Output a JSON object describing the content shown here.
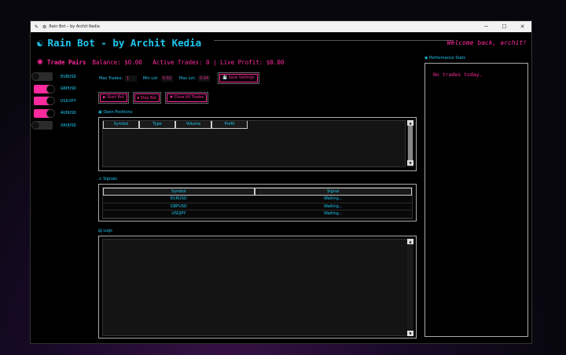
{
  "window": {
    "title": "Rain Bot – by Archit Kedia",
    "controls": [
      "─",
      "☐",
      "✕"
    ]
  },
  "header": {
    "app_title": "Rain Bot - by Archit Kedia",
    "welcome": "Welcome back, archit!"
  },
  "status": {
    "trade_pairs_label": "Trade Pairs",
    "summary": "Balance: $0.00   Active Trades: 0 | Live Profit: $0.00"
  },
  "pairs": [
    {
      "label": "EURUSD",
      "enabled": false
    },
    {
      "label": "GBPUSD",
      "enabled": true
    },
    {
      "label": "USDJPY",
      "enabled": true
    },
    {
      "label": "AUDUSD",
      "enabled": true
    },
    {
      "label": "XAUUSD",
      "enabled": false
    }
  ],
  "settings": {
    "max_trades_label": "Max Trades:",
    "max_trades_value": "1",
    "min_lot_label": "Min Lot:",
    "min_lot_value": "0.02",
    "max_lot_label": "Max Lot:",
    "max_lot_value": "0.04",
    "save_label": "💾 Save Settings"
  },
  "actions": {
    "start_label": "▶ Start Bot",
    "stop_label": "⏹ Stop Bot",
    "close_all_label": "✖ Close All Trades"
  },
  "open_positions": {
    "label": "▣ Open Positions",
    "columns": [
      "Symbol",
      "Type",
      "Volume",
      "Profit"
    ]
  },
  "signals": {
    "label": "⚠ Signals",
    "columns": [
      "Symbol",
      "Signal"
    ],
    "rows": [
      {
        "symbol": "EURUSD",
        "signal": "Waiting..."
      },
      {
        "symbol": "GBPUSD",
        "signal": "Waiting..."
      },
      {
        "symbol": "USDJPY",
        "signal": "Waiting..."
      }
    ]
  },
  "logs": {
    "label": "▤ Logs"
  },
  "performance": {
    "label": "◉ Performance Stats",
    "text": "No trades today."
  },
  "colors": {
    "accent_cyan": "#1ec8f0",
    "accent_pink": "#ff2a9e",
    "background": "#000000"
  }
}
